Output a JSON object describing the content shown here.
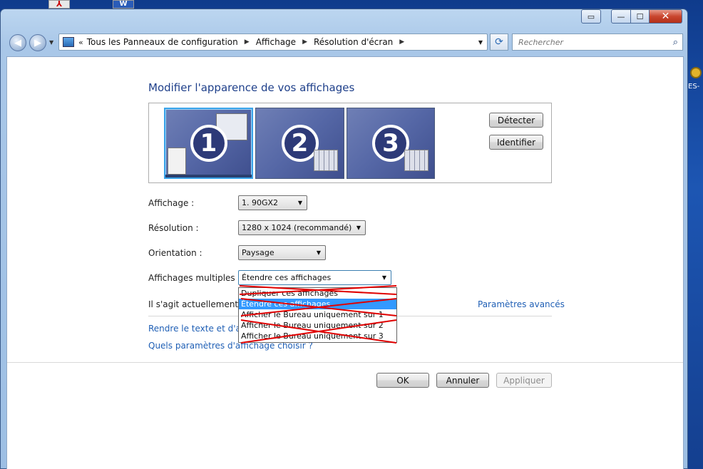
{
  "desktop": {
    "right_label": "ES-"
  },
  "window": {
    "caption": {
      "close_symbol": "✕",
      "max_symbol": "☐",
      "min_symbol": "—"
    }
  },
  "nav": {
    "breadcrumbs": [
      "Tous les Panneaux de configuration",
      "Affichage",
      "Résolution d'écran"
    ],
    "chevron": "«",
    "search_placeholder": "Rechercher"
  },
  "main": {
    "title": "Modifier l'apparence de vos affichages",
    "monitors": [
      {
        "number": "1",
        "selected": true
      },
      {
        "number": "2",
        "selected": false
      },
      {
        "number": "3",
        "selected": false
      }
    ],
    "detect_label": "Détecter",
    "identify_label": "Identifier",
    "display_label": "Affichage :",
    "display_value": "1. 90GX2",
    "resolution_label": "Résolution :",
    "resolution_value": "1280 x 1024 (recommandé)",
    "orientation_label": "Orientation :",
    "orientation_value": "Paysage",
    "multiple_label": "Affichages multiples :",
    "multiple_value": "Étendre ces affichages",
    "multiple_options": [
      "Dupliquer ces affichages",
      "Étendre ces affichages",
      "Afficher le Bureau uniquement sur 1",
      "Afficher le Bureau uniquement sur 2",
      "Afficher le Bureau uniquement sur 3"
    ],
    "highlighted_option_index": 1,
    "current_info": "Il s'agit actuellement de",
    "advanced_link": "Paramètres avancés",
    "text_size_link": "Rendre le texte et d'autre",
    "which_settings_link": "Quels paramètres d'affichage choisir ?"
  },
  "footer": {
    "ok_label": "OK",
    "cancel_label": "Annuler",
    "apply_label": "Appliquer"
  },
  "colors": {
    "title": "#1e3f8a",
    "link": "#1f5fb5",
    "highlight": "#3399ff",
    "selected_monitor_border": "#39a3e9",
    "cross_out": "#e00000"
  }
}
